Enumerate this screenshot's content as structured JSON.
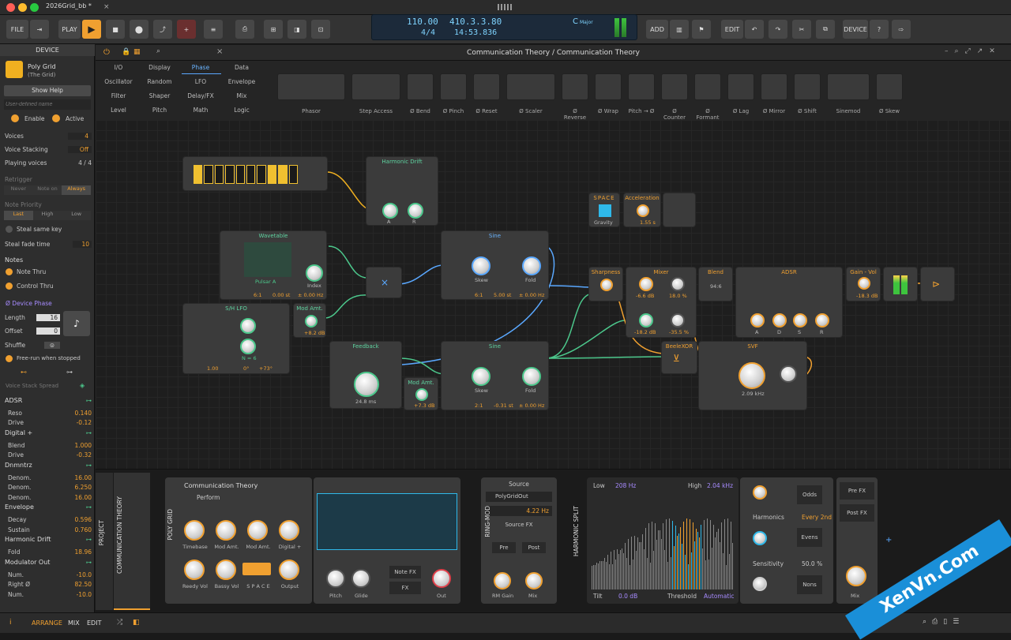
{
  "window": {
    "title": "2026Grid_bb *"
  },
  "toolbar": {
    "file": "FILE",
    "play": "PLAY",
    "add": "ADD",
    "edit": "EDIT",
    "device": "DEVICE"
  },
  "transport": {
    "tempo": "110.00",
    "signature": "4/4",
    "position": "410.3.3.80",
    "time": "14:53.836",
    "key": "C",
    "scale": "Major"
  },
  "left": {
    "title": "DEVICE",
    "device_name": "Poly Grid",
    "device_sub": "(The Grid)",
    "show_help": "Show Help",
    "user_name_placeholder": "User-defined name",
    "enable": "Enable",
    "active": "Active",
    "voices_label": "Voices",
    "voices": "4",
    "stacking_label": "Voice Stacking",
    "stacking": "Off",
    "playing_label": "Playing voices",
    "playing": "4 / 4",
    "retrigger": "Retrigger",
    "retrig_opts": [
      "Never",
      "Note on",
      "Always"
    ],
    "priority": "Note Priority",
    "prio_opts": [
      "Last",
      "High",
      "Low"
    ],
    "steal": "Steal same key",
    "fade_label": "Steal fade time",
    "fade": "10",
    "notes": "Notes",
    "note_thru": "Note Thru",
    "control_thru": "Control Thru",
    "phase": "Ø Device Phase",
    "length_label": "Length",
    "length": "16",
    "offset_label": "Offset",
    "offset": "0",
    "shuffle": "Shuffle",
    "freerun": "Free-run when stopped",
    "spread": "Voice Stack Spread",
    "params": [
      {
        "g": "ADSR"
      },
      {
        "n": "Reso",
        "v": "0.140"
      },
      {
        "n": "Drive",
        "v": "-0.12"
      },
      {
        "g": "Digital +"
      },
      {
        "n": "Blend",
        "v": "1.000"
      },
      {
        "n": "Drive",
        "v": "-0.32"
      },
      {
        "g": "Dnmntrz"
      },
      {
        "n": "Denom.",
        "v": "16.00"
      },
      {
        "n": "Denom.",
        "v": "6.250"
      },
      {
        "n": "Denom.",
        "v": "16.00"
      },
      {
        "g": "Envelope"
      },
      {
        "n": "Decay",
        "v": "0.596"
      },
      {
        "n": "Sustain",
        "v": "0.760"
      },
      {
        "g": "Harmonic Drift"
      },
      {
        "n": "Fold",
        "v": "18.96"
      },
      {
        "g": "Modulator Out"
      },
      {
        "n": "Num.",
        "v": "-10.0"
      },
      {
        "n": "Right Ø",
        "v": "82.50"
      },
      {
        "n": "Num.",
        "v": "-10.0"
      }
    ]
  },
  "graph": {
    "title": "Communication Theory / Communication Theory",
    "categories": [
      [
        "I/O",
        "Display",
        "Phase",
        "Data"
      ],
      [
        "Oscillator",
        "Random",
        "LFO",
        "Envelope"
      ],
      [
        "Filter",
        "Shaper",
        "Delay/FX",
        "Mix"
      ],
      [
        "Level",
        "Pitch",
        "Math",
        "Logic"
      ]
    ],
    "modules": [
      "Phasor",
      "Step Access",
      "Ø Bend",
      "Ø Pinch",
      "Ø Reset",
      "Ø Scaler",
      "Ø Reverse",
      "Ø Wrap",
      "Pitch → Ø",
      "Ø Counter",
      "Ø Formant",
      "Ø Lag",
      "Ø Mirror",
      "Ø Shift",
      "Sinemod",
      "Ø Skew"
    ],
    "nodes": {
      "harmonic": "Harmonic Drift",
      "wavetable": "Wavetable",
      "wt_index": "Index",
      "wt_ratio": "6:1",
      "wt_st": "0.00 st",
      "wt_hz": "± 0.00 Hz",
      "wt_name": "Pulsar A",
      "shlfo": "S/H LFO",
      "sh_rate": "1.00",
      "sh_deg": "0°",
      "sh_off": "+73°",
      "sh_n": "N = 6",
      "modamt1": "Mod Amt.",
      "modamt1_v": "+8.2 dB",
      "sine1": "Sine",
      "s1_skew": "Skew",
      "s1_fold": "Fold",
      "s1_ratio": "6:1",
      "s1_st": "5.00 st",
      "s1_hz": "± 0.00 Hz",
      "feedback": "Feedback",
      "fb_time": "24.8 ms",
      "modamt2": "Mod Amt.",
      "modamt2_v": "+7.3 dB",
      "sine2": "Sine",
      "s2_ratio": "2:1",
      "s2_st": "-0.31 st",
      "s2_hz": "± 0.00 Hz",
      "space": "SPACE",
      "gravity": "Gravity",
      "accel": "Acceleration",
      "accel_v": "1.55 s",
      "sharp": "Sharpness",
      "mixer": "Mixer",
      "mx_a": "-6.6 dB",
      "mx_b": "18.0 %",
      "mx_c": "-18.2 dB",
      "mx_d": "-35.5 %",
      "blend": "Blend",
      "blend_v": "94:6",
      "adsr": "ADSR",
      "gain": "Gain - Vol",
      "gain_v": "-18.3 dB",
      "beeble": "BeeleXOR",
      "svf": "SVF",
      "svf_v": "2.09 kHz",
      "A": "A",
      "D": "D",
      "S": "S",
      "R": "R"
    }
  },
  "bottom": {
    "project": "PROJECT",
    "ct": "COMMUNICATION THEORY",
    "grid": "POLY GRID",
    "preset": "Communication Theory",
    "perform": "Perform",
    "knobs": [
      "Timebase",
      "Mod Amt.",
      "Mod Amt.",
      "Digital +",
      "Reedy Vol",
      "Bassy Vol",
      "S P A C E",
      "Output"
    ],
    "pitch": "Pitch",
    "glide": "Glide",
    "notefx": "Note FX",
    "fx": "FX",
    "out": "Out",
    "ringmod": "RING-MOD",
    "source": "Source",
    "polygridout": "PolyGridOut",
    "freq": "4.22 Hz",
    "sourcefx": "Source FX",
    "pre": "Pre",
    "post": "Post",
    "rmgain": "RM Gain",
    "mix": "Mix",
    "hsplit": "HARMONIC SPLIT",
    "low": "Low",
    "low_v": "208 Hz",
    "high": "High",
    "high_v": "2.04 kHz",
    "tilt": "Tilt",
    "tilt_v": "0.0 dB",
    "threshold": "Threshold",
    "auto": "Automatic",
    "odds": "Odds",
    "harmonics": "Harmonics",
    "every": "Every 2nd",
    "evens": "Evens",
    "sensitivity": "Sensitivity",
    "sens_v": "50.0 %",
    "nons": "Nons",
    "prefx": "Pre FX",
    "postfx": "Post FX",
    "mix2": "Mix"
  },
  "status": {
    "arrange": "ARRANGE",
    "mix": "MIX",
    "edit": "EDIT"
  },
  "watermark": "XenVn.Com"
}
